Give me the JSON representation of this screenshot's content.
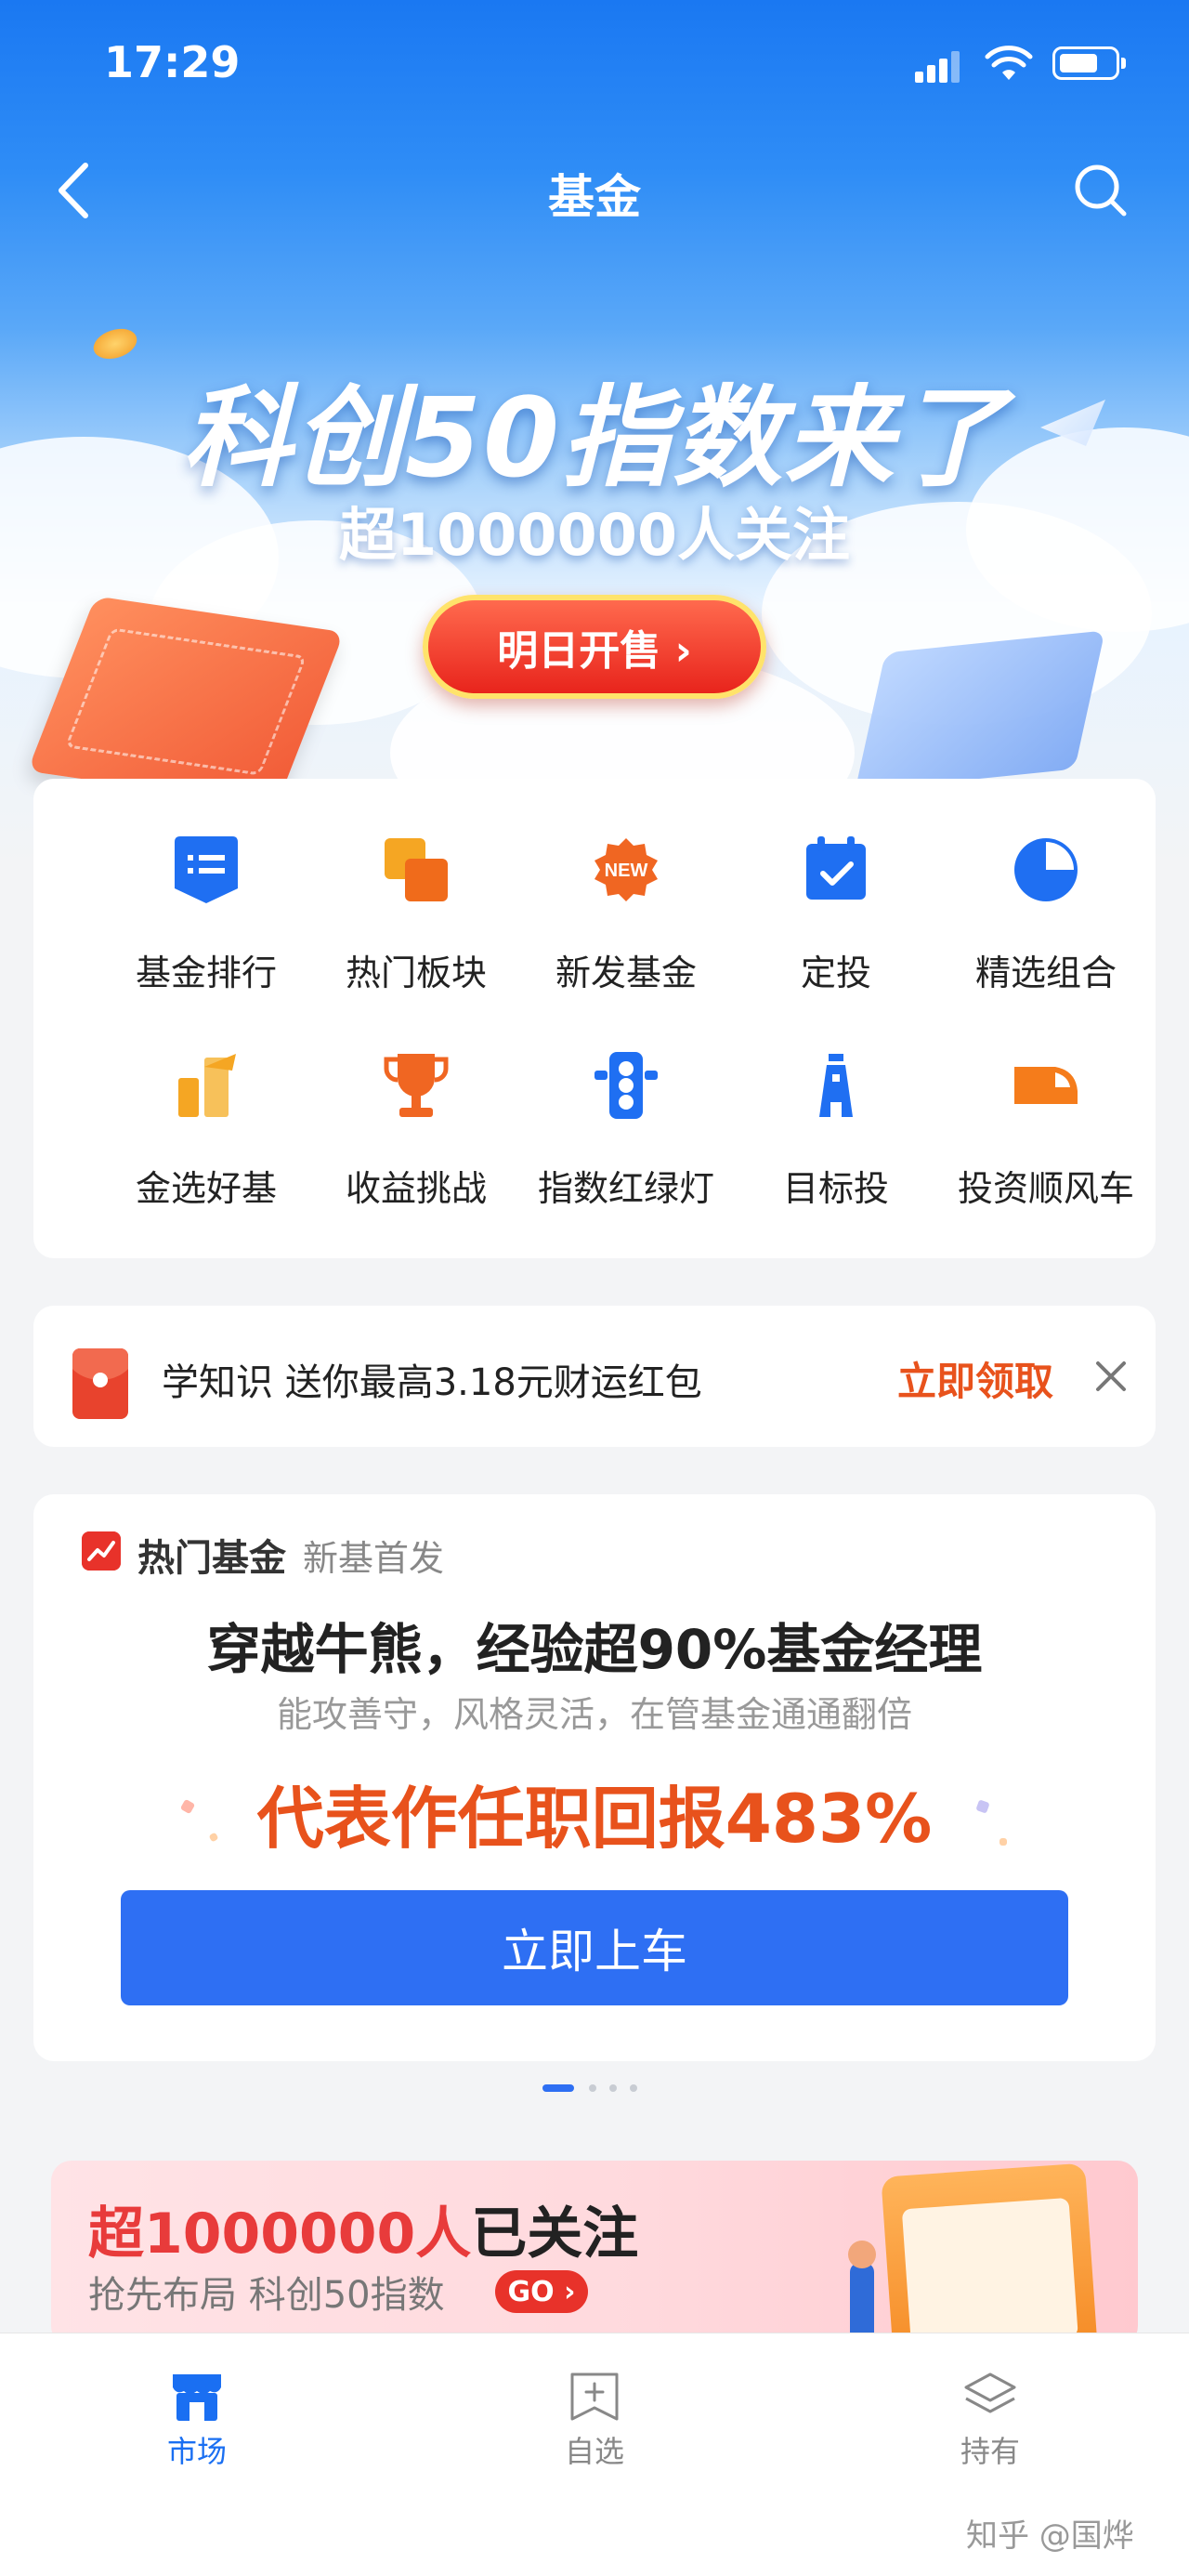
{
  "status_bar": {
    "time": "17:29"
  },
  "nav": {
    "title": "基金"
  },
  "banner": {
    "title": "科创50指数来了",
    "subtitle": "超1000000人关注",
    "button": "明日开售 ›"
  },
  "grid": [
    {
      "label": "基金排行",
      "icon": "ranking-icon",
      "color": "#1f6ff2"
    },
    {
      "label": "热门板块",
      "icon": "hot-sectors-icon",
      "color": "#f07c1b"
    },
    {
      "label": "新发基金",
      "icon": "new-badge-icon",
      "color": "#f06622"
    },
    {
      "label": "定投",
      "icon": "calendar-check-icon",
      "color": "#1f6ff2"
    },
    {
      "label": "精选组合",
      "icon": "pie-chart-icon",
      "color": "#1f6ff2"
    },
    {
      "label": "金选好基",
      "icon": "gold-pick-icon",
      "color": "#f5a623"
    },
    {
      "label": "收益挑战",
      "icon": "trophy-icon",
      "color": "#f06622"
    },
    {
      "label": "指数红绿灯",
      "icon": "traffic-light-icon",
      "color": "#1f6ff2"
    },
    {
      "label": "目标投",
      "icon": "lighthouse-icon",
      "color": "#1f6ff2"
    },
    {
      "label": "投资顺风车",
      "icon": "car-icon",
      "color": "#f57c1b"
    }
  ],
  "promo": {
    "text": "学知识 送你最高3.18元财运红包",
    "action": "立即领取"
  },
  "hot_fund": {
    "tag": "热门基金",
    "tag2": "新基首发",
    "headline": "穿越牛熊，经验超90%基金经理",
    "desc": "能攻善守，风格灵活，在管基金通通翻倍",
    "return_text": "代表作任职回报483%",
    "button": "立即上车"
  },
  "bottom_banner": {
    "title_red": "超1000000人",
    "title_black": "已关注",
    "subtitle": "抢先布局 科创50指数",
    "go": "GO ›"
  },
  "tabs": [
    {
      "label": "市场",
      "icon": "market-icon",
      "active": true
    },
    {
      "label": "自选",
      "icon": "watchlist-add-icon",
      "active": false
    },
    {
      "label": "持有",
      "icon": "holdings-layers-icon",
      "active": false
    }
  ],
  "watermark": "知乎 @国烨"
}
